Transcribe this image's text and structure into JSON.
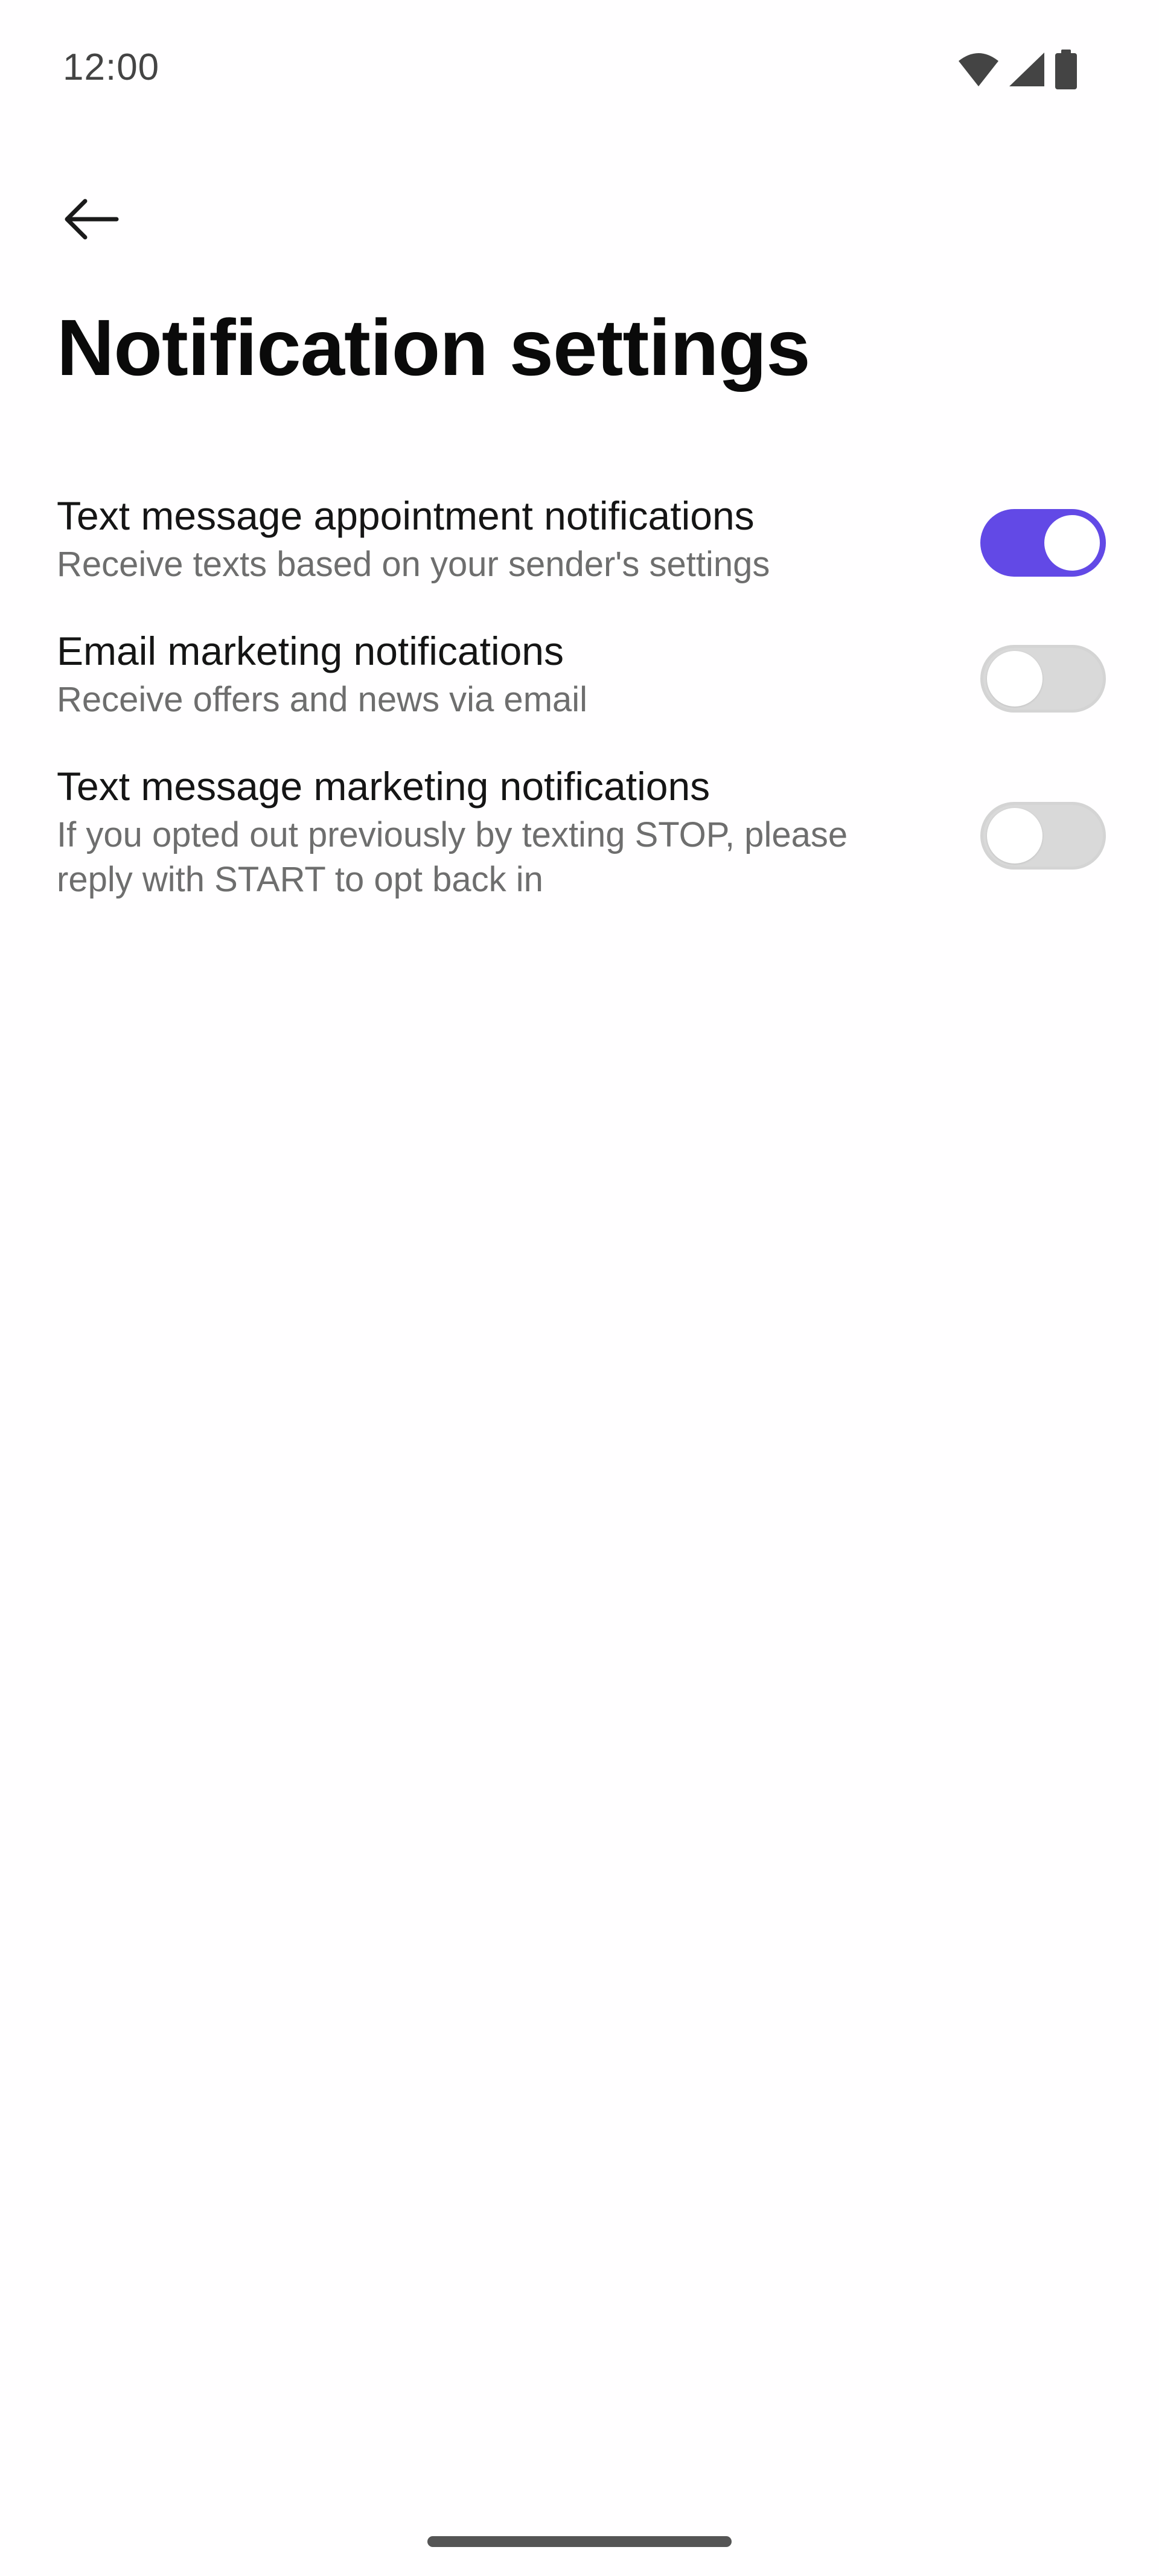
{
  "status_bar": {
    "time": "12:00",
    "icons": [
      "wifi-icon",
      "signal-icon",
      "battery-icon"
    ]
  },
  "header": {
    "back_icon": "arrow-left-icon",
    "title": "Notification settings"
  },
  "settings": [
    {
      "title": "Text message appointment notifications",
      "description": "Receive texts based on your sender's settings",
      "enabled": true
    },
    {
      "title": "Email marketing notifications",
      "description": "Receive offers and news via email",
      "enabled": false
    },
    {
      "title": "Text message marketing notifications",
      "description": "If you opted out previously by texting STOP, please reply with START to opt back in",
      "enabled": false
    }
  ],
  "colors": {
    "accent": "#6249e6",
    "toggle_off": "#d9d9d9",
    "background": "#fffeff",
    "text_primary": "#151515",
    "text_secondary": "#6e6e6e"
  }
}
